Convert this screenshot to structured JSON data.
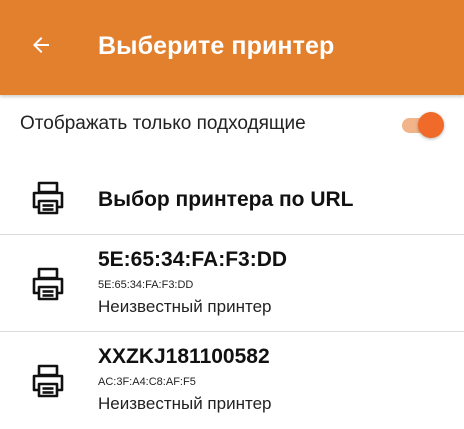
{
  "header": {
    "title": "Выберите принтер",
    "back_icon": "arrow-left-icon",
    "background": "#E2802D"
  },
  "filter": {
    "label": "Отображать только подходящие",
    "enabled": true,
    "accent": "#F06A29"
  },
  "url_option": {
    "label": "Выбор принтера по URL",
    "icon": "printer-icon"
  },
  "printers": [
    {
      "name": "5E:65:34:FA:F3:DD",
      "mac": "5E:65:34:FA:F3:DD",
      "status": "Неизвестный принтер",
      "icon": "printer-icon"
    },
    {
      "name": "XXZKJ181100582",
      "mac": "AC:3F:A4:C8:AF:F5",
      "status": "Неизвестный принтер",
      "icon": "printer-icon"
    }
  ]
}
